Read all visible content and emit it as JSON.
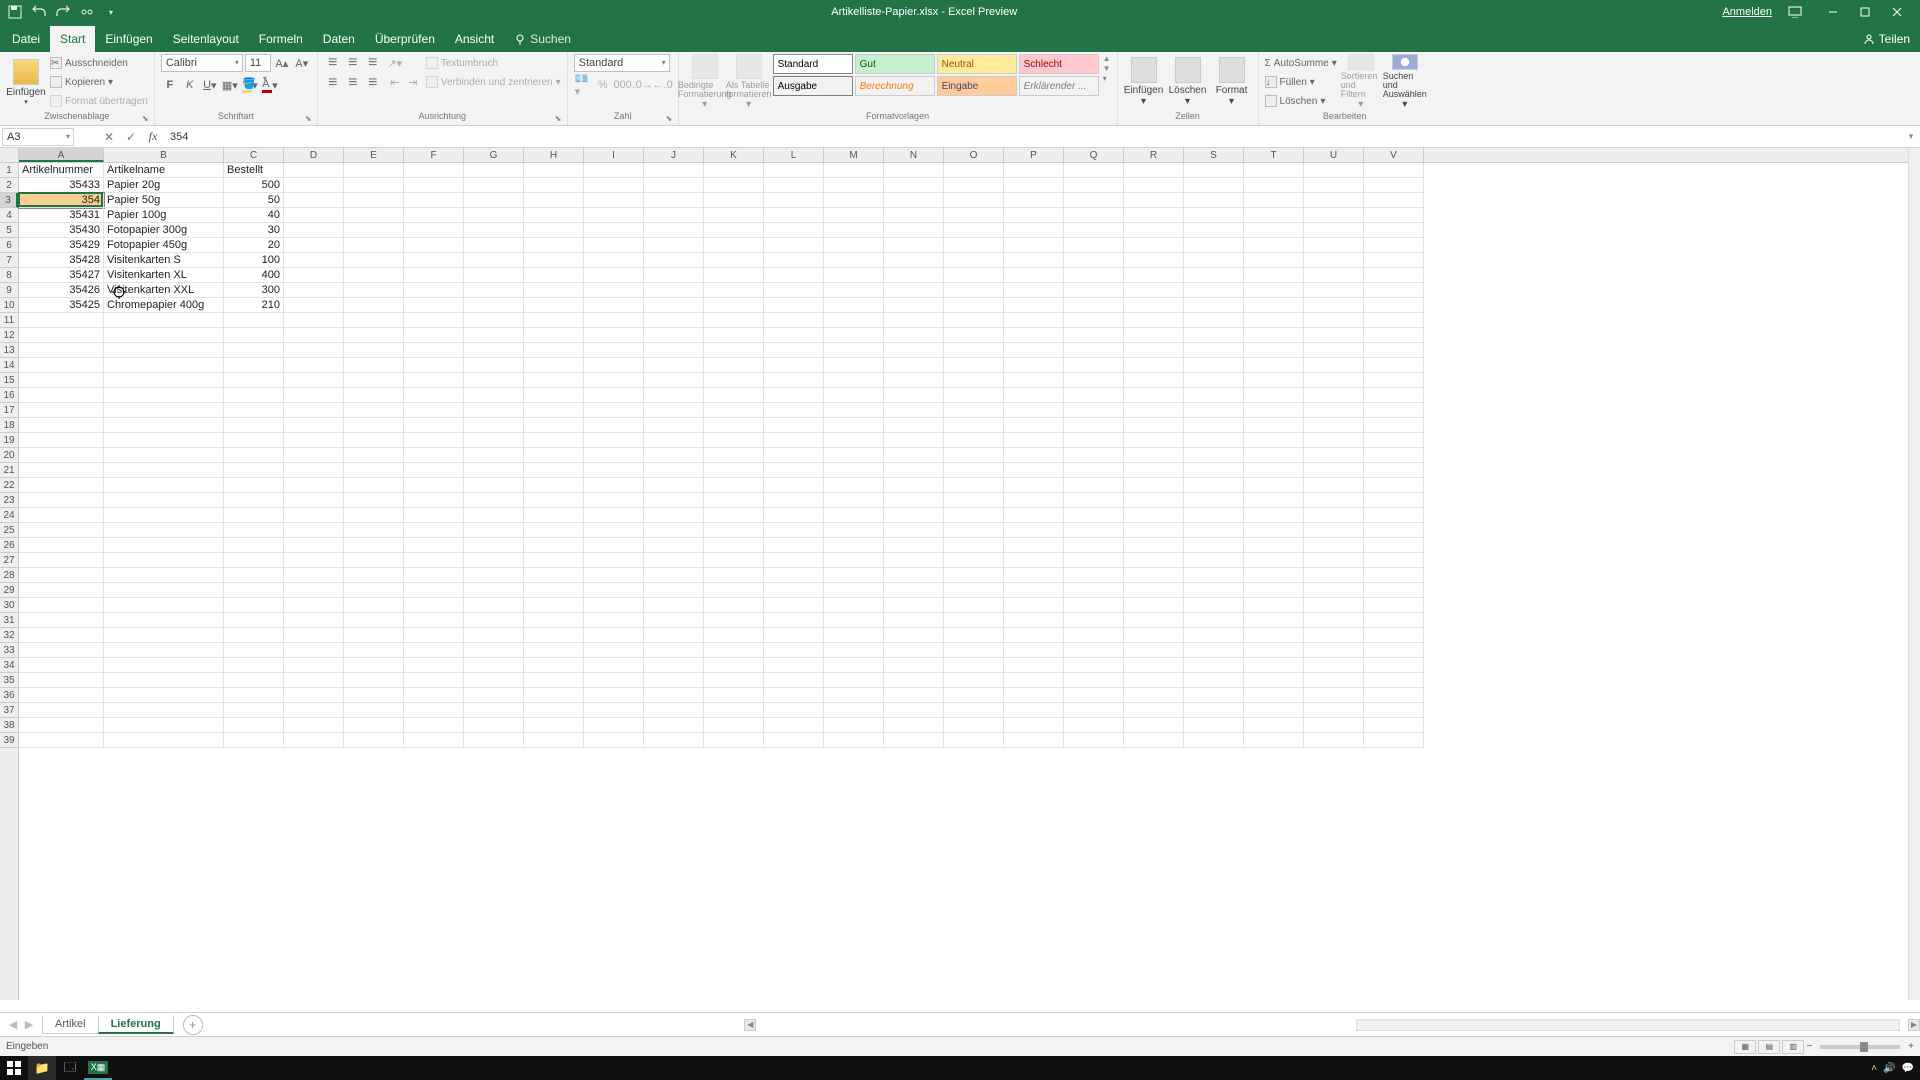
{
  "title": {
    "filename": "Artikelliste-Papier.xlsx",
    "sep": "  -  ",
    "app": "Excel Preview"
  },
  "signin": "Anmelden",
  "tabs": {
    "file": "Datei",
    "home": "Start",
    "insert": "Einfügen",
    "layout": "Seitenlayout",
    "formulas": "Formeln",
    "data": "Daten",
    "review": "Überprüfen",
    "view": "Ansicht",
    "search": "Suchen",
    "share": "Teilen"
  },
  "clipboard": {
    "paste": "Einfügen",
    "cut": "Ausschneiden",
    "copy": "Kopieren",
    "format_painter": "Format übertragen",
    "label": "Zwischenablage"
  },
  "font": {
    "name": "Calibri",
    "size": "11",
    "label": "Schriftart"
  },
  "alignment": {
    "wrap": "Textumbruch",
    "merge": "Verbinden und zentrieren",
    "label": "Ausrichtung"
  },
  "numbergrp": {
    "format": "Standard",
    "label": "Zahl"
  },
  "condformat": {
    "cond": "Bedingte Formatierung",
    "table": "Als Tabelle formatieren",
    "label": "Formatvorlagen"
  },
  "styles": {
    "standard": "Standard",
    "gut": "Gut",
    "neutral": "Neutral",
    "schlecht": "Schlecht",
    "ausgabe": "Ausgabe",
    "berechnung": "Berechnung",
    "eingabe": "Eingabe",
    "erklaer": "Erklärender ..."
  },
  "cellsgrp": {
    "insert": "Einfügen",
    "delete": "Löschen",
    "format": "Format",
    "label": "Zellen"
  },
  "editing": {
    "sum": "AutoSumme",
    "fill": "Füllen",
    "clear": "Löschen",
    "sort": "Sortieren und Filtern",
    "find": "Suchen und Auswählen",
    "label": "Bearbeiten"
  },
  "namebox": "A3",
  "formula_value": "354",
  "columns": [
    "A",
    "B",
    "C",
    "D",
    "E",
    "F",
    "G",
    "H",
    "I",
    "J",
    "K",
    "L",
    "M",
    "N",
    "O",
    "P",
    "Q",
    "R",
    "S",
    "T",
    "U",
    "V"
  ],
  "col_widths": {
    "A": 85,
    "B": 120,
    "default": 60
  },
  "headers": {
    "a": "Artikelnummer",
    "b": "Artikelname",
    "c": "Bestellt"
  },
  "data_rows": [
    {
      "num": "35433",
      "name": "Papier 20g",
      "qty": "500"
    },
    {
      "num": "354",
      "name": "Papier 50g",
      "qty": "50",
      "editing": true
    },
    {
      "num": "35431",
      "name": "Papier 100g",
      "qty": "40"
    },
    {
      "num": "35430",
      "name": "Fotopapier 300g",
      "qty": "30"
    },
    {
      "num": "35429",
      "name": "Fotopapier 450g",
      "qty": "20"
    },
    {
      "num": "35428",
      "name": "Visitenkarten S",
      "qty": "100"
    },
    {
      "num": "35427",
      "name": "Visitenkarten XL",
      "qty": "400"
    },
    {
      "num": "35426",
      "name": "Visitenkarten XXL",
      "qty": "300"
    },
    {
      "num": "35425",
      "name": "Chromepapier 400g",
      "qty": "210"
    }
  ],
  "total_visible_rows": 39,
  "selected_row": 3,
  "selected_col": "A",
  "sheets": {
    "s1": "Artikel",
    "s2": "Lieferung"
  },
  "status": "Eingeben"
}
